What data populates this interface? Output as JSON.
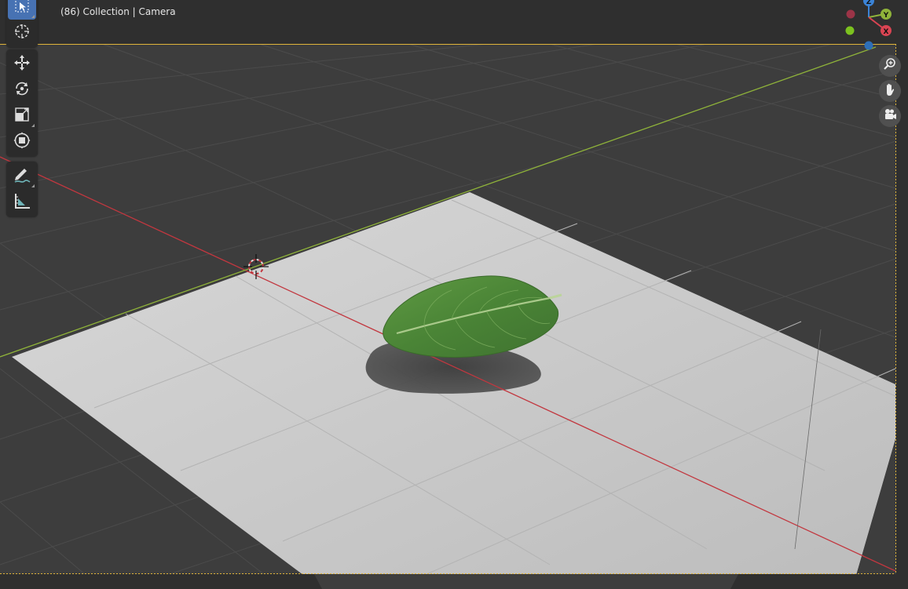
{
  "viewport": {
    "header_text": "(86) Collection | Camera",
    "colors": {
      "background": "#3d3d3d",
      "grid_line": "#4a4a4a",
      "ground_plane": "#cfcfcf",
      "x_axis": "#c2373f",
      "y_axis": "#8fb33a",
      "camera_frame": "#e0b43a",
      "leaf": "#4f8a3a"
    }
  },
  "toolbar": {
    "tools": [
      "select-box",
      "cursor",
      "move",
      "rotate",
      "scale",
      "transform",
      "annotate",
      "measure"
    ]
  },
  "gizmo": {
    "axes": [
      {
        "label": "Z",
        "color": "#3b83d6"
      },
      {
        "label": "Y",
        "color": "#8fb33a"
      },
      {
        "label": "X",
        "color": "#d94452"
      }
    ]
  },
  "navigation": {
    "buttons": [
      "zoom-icon",
      "hand-pan-icon",
      "camera-view-icon"
    ]
  }
}
